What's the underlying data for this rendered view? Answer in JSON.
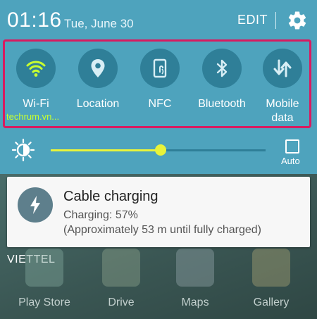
{
  "status": {
    "time": "01:16",
    "date": "Tue, June 30",
    "edit_label": "EDIT"
  },
  "quick_settings": {
    "tiles": [
      {
        "label": "Wi-Fi",
        "icon": "wifi-icon",
        "active": true
      },
      {
        "label": "Location",
        "icon": "location-pin-icon",
        "active": false
      },
      {
        "label": "NFC",
        "icon": "nfc-icon",
        "active": false
      },
      {
        "label": "Bluetooth",
        "icon": "bluetooth-icon",
        "active": false
      },
      {
        "label": "Mobile\ndata",
        "icon": "mobile-data-icon",
        "active": false
      }
    ],
    "watermark": "techrum.vn..."
  },
  "brightness": {
    "level_percent": 51,
    "auto_label": "Auto",
    "auto_checked": false
  },
  "notification": {
    "title": "Cable charging",
    "line1": "Charging: 57%",
    "line2": "(Approximately 53 m until fully charged)",
    "icon": "lightning-bolt-icon"
  },
  "homescreen": {
    "carrier": "VIETTEL",
    "apps": [
      {
        "label": "Play Store"
      },
      {
        "label": "Drive"
      },
      {
        "label": "Maps"
      },
      {
        "label": "Gallery"
      }
    ]
  },
  "colors": {
    "panel": "#4ea3bd",
    "tile_circle": "#2f7f98",
    "wifi_active": "#c8ff2e",
    "slider": "#e8f33a",
    "highlight_border": "#d81b60"
  }
}
